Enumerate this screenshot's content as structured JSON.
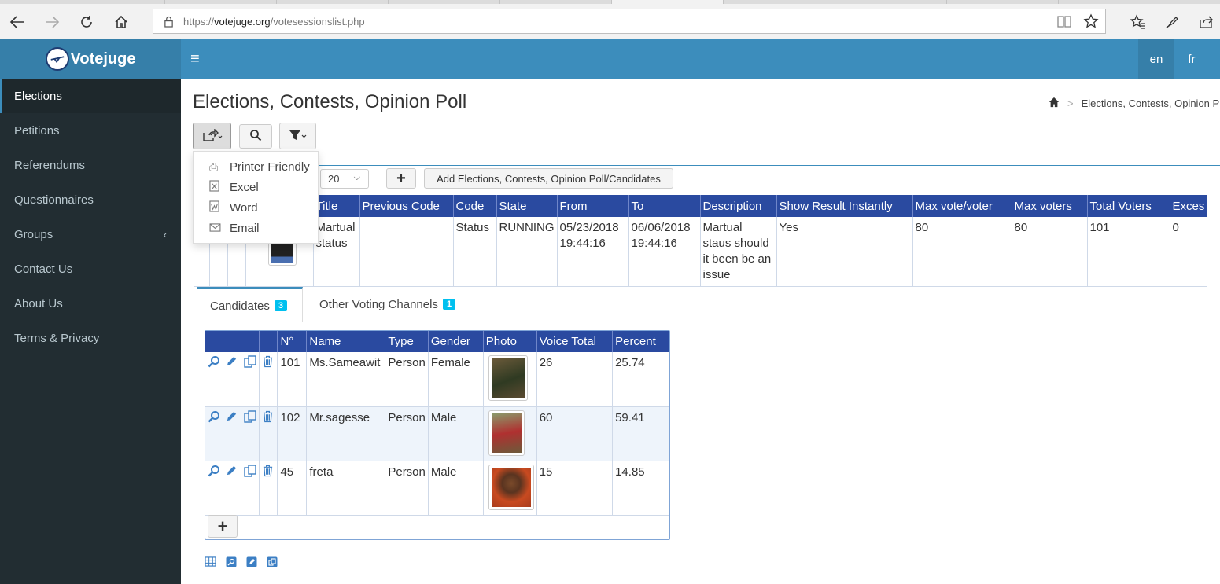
{
  "browser": {
    "url_prefix": "https://",
    "url_host": "votejuge.org",
    "url_path": "/votesessionslist.php"
  },
  "app": {
    "brand": "Votejuge",
    "languages": [
      "en",
      "fr"
    ]
  },
  "sidebar": {
    "items": [
      {
        "label": "Elections"
      },
      {
        "label": "Petitions"
      },
      {
        "label": "Referendums"
      },
      {
        "label": "Questionnaires"
      },
      {
        "label": "Groups"
      },
      {
        "label": "Contact Us"
      },
      {
        "label": "About Us"
      },
      {
        "label": "Terms & Privacy"
      }
    ]
  },
  "page": {
    "title": "Elections, Contests, Opinion Poll",
    "breadcrumb": "Elections, Contests, Opinion P"
  },
  "export_menu": {
    "items": [
      "Printer Friendly",
      "Excel",
      "Word",
      "Email"
    ]
  },
  "list": {
    "page_size": "20",
    "add_button": "Add Elections, Contests, Opinion Poll/Candidates",
    "columns": [
      "Title",
      "Previous Code",
      "Code",
      "State",
      "From",
      "To",
      "Description",
      "Show Result Instantly",
      "Max vote/voter",
      "Max voters",
      "Total Voters",
      "Exces"
    ],
    "row": {
      "title": "Martual status",
      "previous_code": "",
      "code": "Status",
      "state": "RUNNING",
      "from": "05/23/2018 19:44:16",
      "to": "06/06/2018 19:44:16",
      "description": "Martual staus should it been be an issue",
      "show_result": "Yes",
      "max_vote_voter": "80",
      "max_voters": "80",
      "total_voters": "101",
      "excess": "0"
    }
  },
  "tabs": {
    "candidates": {
      "label": "Candidates",
      "count": "3"
    },
    "other": {
      "label": "Other Voting Channels",
      "count": "1"
    }
  },
  "candidates": {
    "columns": [
      "N°",
      "Name",
      "Type",
      "Gender",
      "Photo",
      "Voice Total",
      "Percent"
    ],
    "rows": [
      {
        "no": "101",
        "name": "Ms.Sameawit",
        "type": "Person",
        "gender": "Female",
        "voice_total": "26",
        "percent": "25.74"
      },
      {
        "no": "102",
        "name": "Mr.sagesse",
        "type": "Person",
        "gender": "Male",
        "voice_total": "60",
        "percent": "59.41"
      },
      {
        "no": "45",
        "name": "freta",
        "type": "Person",
        "gender": "Male",
        "voice_total": "15",
        "percent": "14.85"
      }
    ]
  },
  "colors": {
    "header_blue": "#3c8dbc",
    "sidebar_dark": "#222d32",
    "table_header": "#2a4aa0",
    "badge": "#00c0ef"
  }
}
